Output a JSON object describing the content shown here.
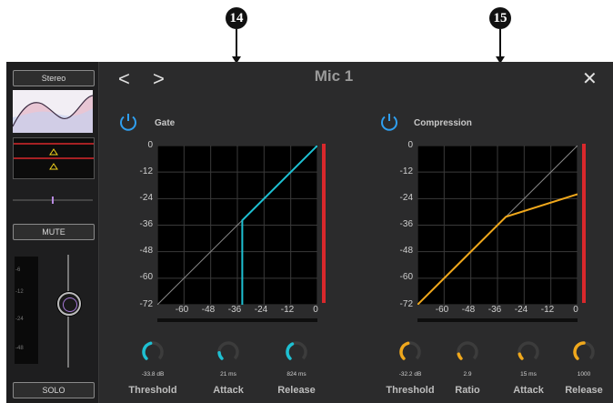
{
  "callouts": [
    "14",
    "15"
  ],
  "window": {
    "title": "Mic 1",
    "back": "<",
    "forward": ">",
    "close": "✕"
  },
  "strip": {
    "stereo": "Stereo",
    "mute": "MUTE",
    "solo": "SOLO",
    "meter_marks": [
      "-6",
      "-12",
      "-24",
      "-48"
    ]
  },
  "gate": {
    "label": "Gate",
    "color": "#1ec0d2",
    "threshold_db": -33.8,
    "y_ticks": [
      "0",
      "-12",
      "-24",
      "-36",
      "-48",
      "-60",
      "-72"
    ],
    "x_ticks": [
      "-60",
      "-48",
      "-36",
      "-24",
      "-12",
      "0"
    ],
    "knobs": [
      {
        "value": "-33.8 dB",
        "label": "Threshold",
        "level": 0.45
      },
      {
        "value": "21 ms",
        "label": "Attack",
        "level": 0.15
      },
      {
        "value": "824 ms",
        "label": "Release",
        "level": 0.4
      }
    ]
  },
  "compression": {
    "label": "Compression",
    "color": "#f0a81c",
    "threshold_db": -32.2,
    "output_at_0db": -22,
    "y_ticks": [
      "0",
      "-12",
      "-24",
      "-36",
      "-48",
      "-60",
      "-72"
    ],
    "x_ticks": [
      "-60",
      "-48",
      "-36",
      "-24",
      "-12",
      "0"
    ],
    "knobs": [
      {
        "value": "-32.2  dB",
        "label": "Threshold",
        "level": 0.45
      },
      {
        "value": "2.9",
        "label": "Ratio",
        "level": 0.12
      },
      {
        "value": "15  ms",
        "label": "Attack",
        "level": 0.12
      },
      {
        "value": "1000",
        "label": "Release",
        "level": 0.5
      }
    ]
  }
}
